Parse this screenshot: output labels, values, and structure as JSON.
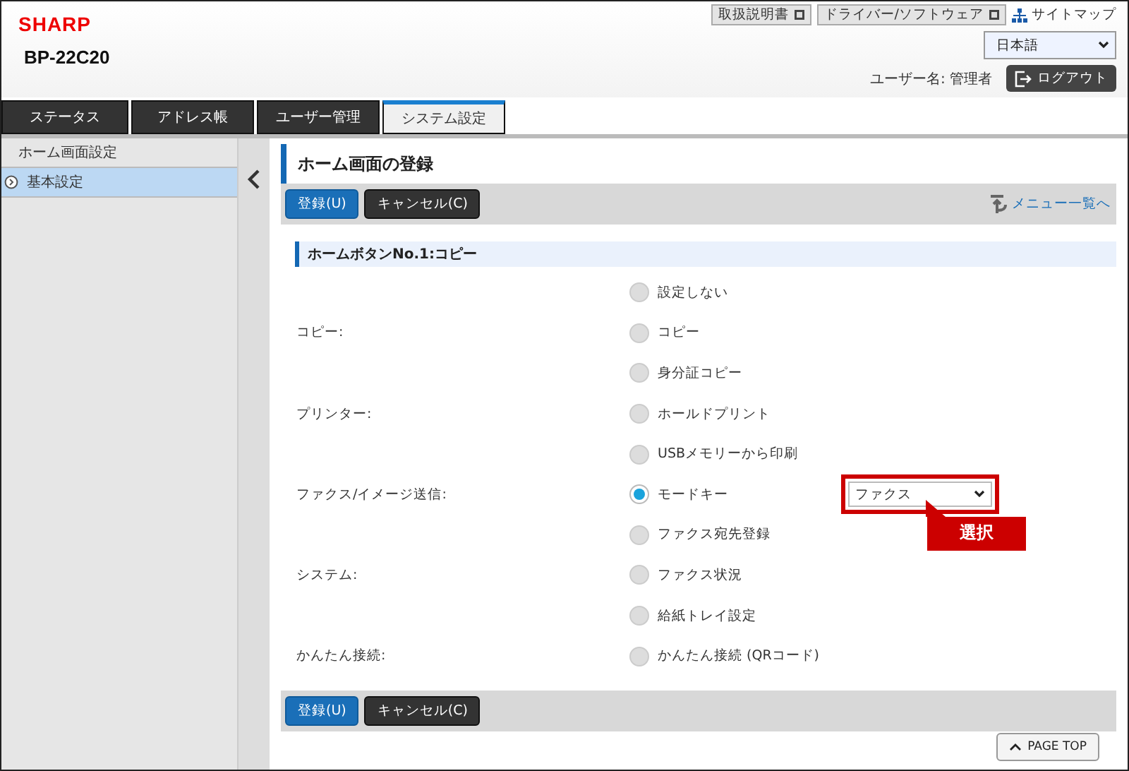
{
  "header": {
    "brand": "SHARP",
    "model": "BP-22C20",
    "links": [
      {
        "label": "取扱説明書",
        "kind": "external"
      },
      {
        "label": "ドライバー/ソフトウェア",
        "kind": "external"
      },
      {
        "label": "サイトマップ",
        "kind": "sitemap"
      }
    ],
    "language": "日本語",
    "user": "ユーザー名: 管理者",
    "logout": "ログアウト"
  },
  "tabs": [
    {
      "label": "ステータス",
      "selected": false
    },
    {
      "label": "アドレス帳",
      "selected": false
    },
    {
      "label": "ユーザー管理",
      "selected": false
    },
    {
      "label": "システム設定",
      "selected": true
    }
  ],
  "sidebar": {
    "items": [
      {
        "label": "ホーム画面設定",
        "selected": false,
        "kind": "heading"
      },
      {
        "label": "基本設定",
        "selected": true,
        "kind": "link"
      }
    ]
  },
  "page": {
    "title": "ホーム画面の登録",
    "buttons": [
      {
        "label": "登録(U)",
        "kind": "primary"
      },
      {
        "label": "キャンセル(C)",
        "kind": "secondary"
      }
    ],
    "menu_link": "メニュー一覧へ",
    "section": "ホームボタンNo.1:コピー",
    "rows": [
      {
        "option": "設定しない",
        "selected": false
      },
      {
        "category": "コピー:",
        "option": "コピー",
        "selected": false
      },
      {
        "option": "身分証コピー",
        "selected": false
      },
      {
        "category": "プリンター:",
        "option": "ホールドプリント",
        "selected": false
      },
      {
        "option": "USBメモリーから印刷",
        "selected": false
      },
      {
        "category": "ファクス/イメージ送信:",
        "option": "モードキー",
        "selected": true,
        "select": "ファクス",
        "callout": "選択"
      },
      {
        "option": "ファクス宛先登録",
        "selected": false
      },
      {
        "category": "システム:",
        "option": "ファクス状況",
        "selected": false
      },
      {
        "option": "給紙トレイ設定",
        "selected": false
      },
      {
        "category": "かんたん接続:",
        "option": "かんたん接続 (QRコード)",
        "selected": false
      }
    ],
    "bottom_buttons": [
      {
        "label": "登録(U)",
        "kind": "primary"
      },
      {
        "label": "キャンセル(C)",
        "kind": "secondary"
      }
    ],
    "page_top": "PAGE TOP"
  }
}
